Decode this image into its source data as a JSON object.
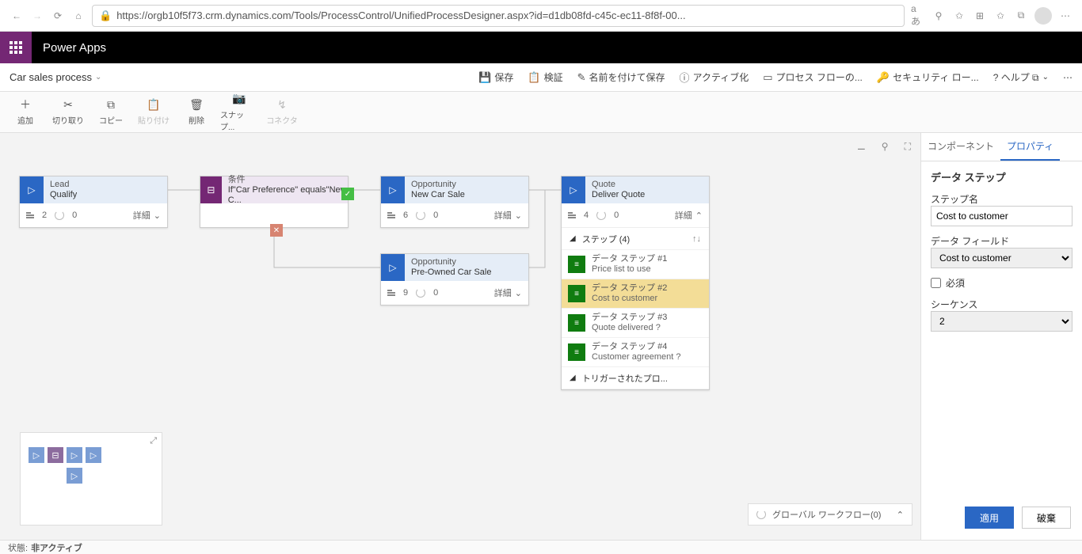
{
  "browser": {
    "url": "https://orgb10f5f73.crm.dynamics.com/Tools/ProcessControl/UnifiedProcessDesigner.aspx?id=d1db08fd-c45c-ec11-8f8f-00..."
  },
  "header": {
    "appName": "Power Apps"
  },
  "commandBar": {
    "processName": "Car sales process",
    "save": "保存",
    "validate": "検証",
    "saveAs": "名前を付けて保存",
    "activate": "アクティブ化",
    "orderFlow": "プロセス フローの...",
    "security": "セキュリティ ロー...",
    "help": "? ヘルプ ⧉"
  },
  "toolbar": {
    "add": "追加",
    "cut": "切り取り",
    "copy": "コピー",
    "paste": "貼り付け",
    "delete": "削除",
    "snapshot": "スナップ...",
    "connector": "コネクタ"
  },
  "stages": {
    "lead": {
      "entity": "Lead",
      "name": "Qualify",
      "steps": "2",
      "spin": "0",
      "detail": "詳細"
    },
    "cond": {
      "label": "条件",
      "expr": "If\"Car Preference\" equals\"New C..."
    },
    "opp1": {
      "entity": "Opportunity",
      "name": "New Car Sale",
      "steps": "6",
      "spin": "0",
      "detail": "詳細"
    },
    "opp2": {
      "entity": "Opportunity",
      "name": "Pre-Owned Car Sale",
      "steps": "9",
      "spin": "0",
      "detail": "詳細"
    },
    "quote": {
      "entity": "Quote",
      "name": "Deliver Quote",
      "steps": "4",
      "spin": "0",
      "detail": "詳細",
      "stepsHdr": "ステップ (4)",
      "items": [
        {
          "t": "データ ステップ #1",
          "s": "Price list to use"
        },
        {
          "t": "データ ステップ #2",
          "s": "Cost to customer"
        },
        {
          "t": "データ ステップ #3",
          "s": "Quote delivered ?"
        },
        {
          "t": "データ ステップ #4",
          "s": "Customer agreement ?"
        }
      ],
      "trigger": "トリガーされたプロ..."
    }
  },
  "globalWf": "グローバル ワークフロー(0)",
  "panel": {
    "tabComponents": "コンポーネント",
    "tabProperties": "プロパティ",
    "sectionTitle": "データ ステップ",
    "stepNameLabel": "ステップ名",
    "stepNameValue": "Cost to customer",
    "dataFieldLabel": "データ フィールド",
    "dataFieldValue": "Cost to customer",
    "requiredLabel": "必須",
    "sequenceLabel": "シーケンス",
    "sequenceValue": "2",
    "apply": "適用",
    "discard": "破棄"
  },
  "status": {
    "label": "状態:",
    "value": "非アクティブ"
  }
}
